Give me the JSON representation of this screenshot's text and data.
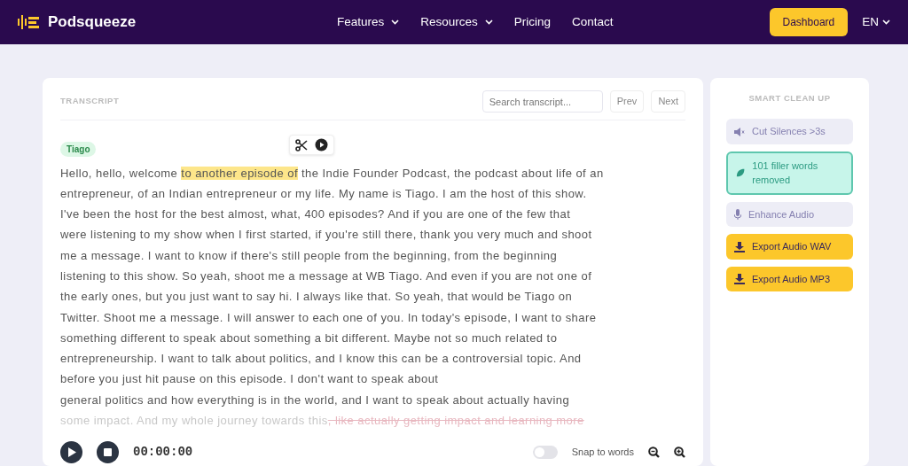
{
  "navbar": {
    "brand": "Podsqueeze",
    "links": [
      {
        "label": "Features",
        "dropdown": true
      },
      {
        "label": "Resources",
        "dropdown": true
      },
      {
        "label": "Pricing",
        "dropdown": false
      },
      {
        "label": "Contact",
        "dropdown": false
      }
    ],
    "dashboard": "Dashboard",
    "language": "EN"
  },
  "transcript": {
    "title": "TRANSCRIPT",
    "search": {
      "placeholder": "Search transcript..."
    },
    "prev": "Prev",
    "next": "Next",
    "speaker": "Tiago",
    "lines": [
      [
        {
          "text": "Hello, hello, welcome ",
          "kind": "plain"
        },
        {
          "text": "to another episode of",
          "kind": "highlight"
        },
        {
          "text": " the Indie Founder Podcast, the podcast about life of an",
          "kind": "plain"
        }
      ],
      [
        {
          "text": "entrepreneur, of an Indian entrepreneur or my life. My name is Tiago. I am the host of this show.",
          "kind": "plain"
        }
      ],
      [
        {
          "text": "I've been the host for the best almost, what, 400 episodes? And if you are one of the few that",
          "kind": "plain"
        }
      ],
      [
        {
          "text": "were listening to my show when I first started, if you're still there, thank you very much and shoot",
          "kind": "plain"
        }
      ],
      [
        {
          "text": "me a message. I want to know if there's still people from the beginning, from the beginning",
          "kind": "plain"
        }
      ],
      [
        {
          "text": "listening to this show. So yeah, shoot me a message at WB Tiago. And even if you are not one of",
          "kind": "plain"
        }
      ],
      [
        {
          "text": "the early ones, but you just want to say hi. I always like that. So yeah, that would be Tiago on",
          "kind": "plain"
        }
      ],
      [
        {
          "text": "Twitter. Shoot me a message. I will answer to each one of you. In today's episode, I want to share",
          "kind": "plain"
        }
      ],
      [
        {
          "text": "something different to speak about something a bit different. Maybe not so much related to",
          "kind": "plain"
        }
      ],
      [
        {
          "text": "entrepreneurship. I want to talk about politics, and I know this can be a controversial topic. And",
          "kind": "plain"
        }
      ],
      [
        {
          "text": "before you just hit pause on this episode. I don't want to speak about",
          "kind": "plain"
        }
      ],
      [
        {
          "text": "general politics and how everything is in the world, and I want to speak about actually having",
          "kind": "plain"
        }
      ],
      [
        {
          "text": "some impact. And my whole journey towards this",
          "kind": "faded"
        },
        {
          "text": ", like actually getting impact and learning more",
          "kind": "struck"
        }
      ]
    ]
  },
  "player": {
    "time": "00:00:00",
    "snap": {
      "label": "Snap to words",
      "on": false
    }
  },
  "cleanup": {
    "title": "SMART CLEAN UP",
    "actions": [
      {
        "kind": "silence",
        "label": "Cut Silences >3s"
      },
      {
        "kind": "filler",
        "label": "101 filler words removed"
      },
      {
        "kind": "enhance",
        "label": "Enhance Audio"
      },
      {
        "kind": "export",
        "label": "Export Audio WAV"
      },
      {
        "kind": "export",
        "label": "Export Audio MP3"
      }
    ]
  }
}
